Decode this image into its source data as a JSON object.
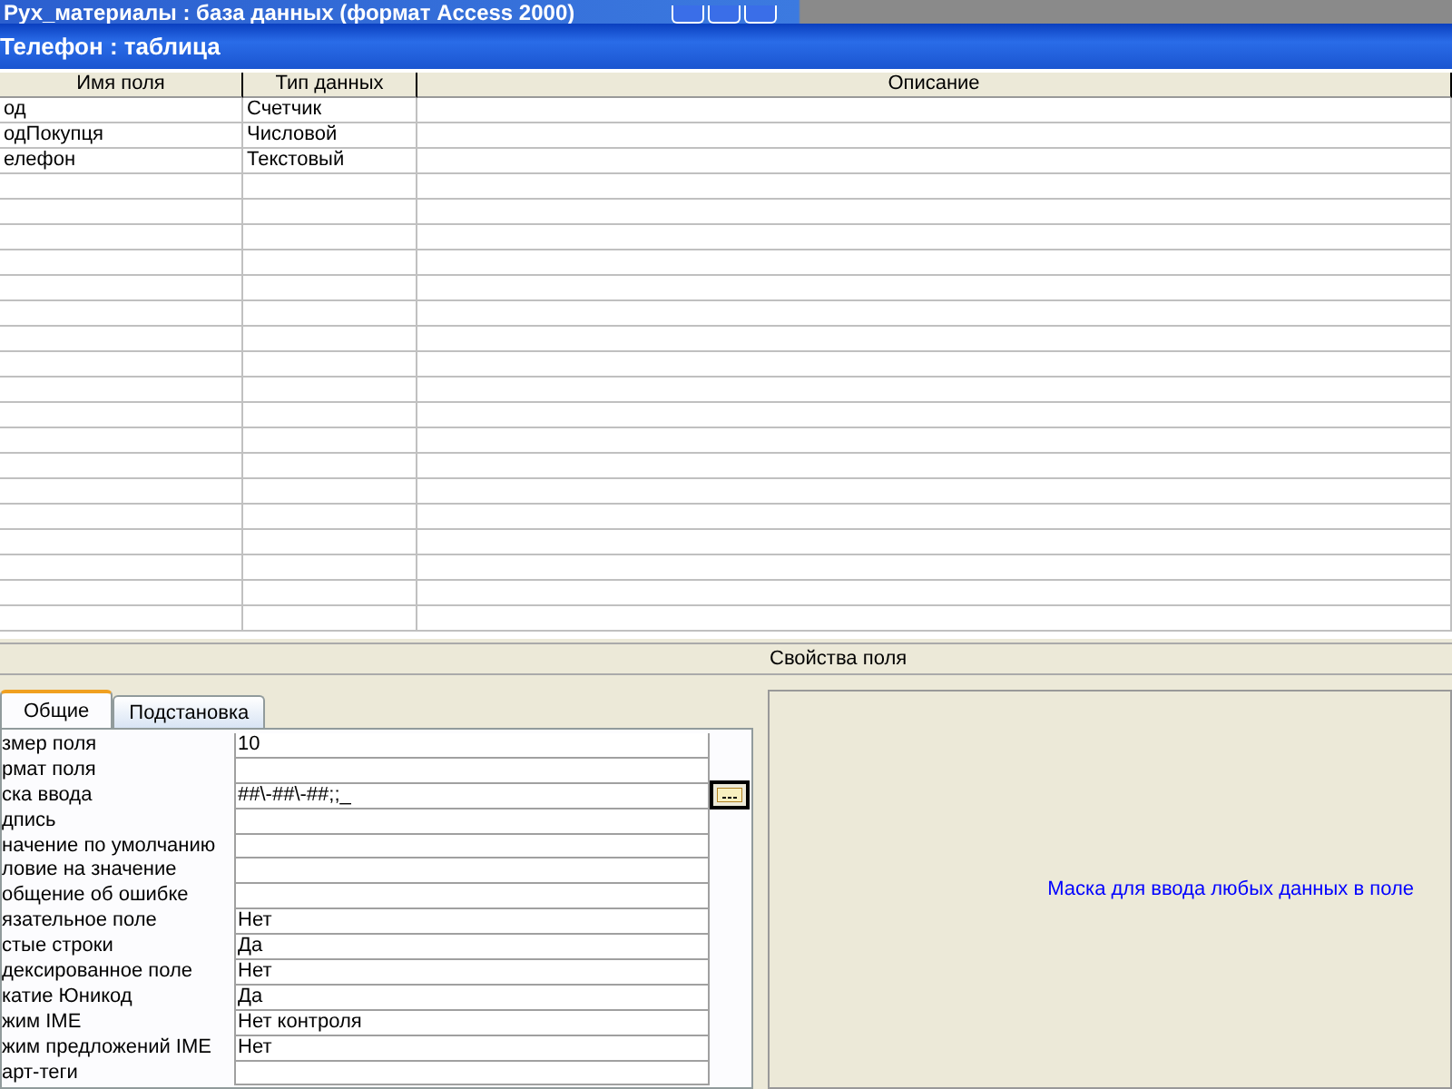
{
  "app_title": "Рух_материалы : база данных (формат Access 2000)",
  "window": {
    "title": "Телефон : таблица"
  },
  "table": {
    "columns": [
      "Имя поля",
      "Тип данных",
      "Описание"
    ],
    "rows": [
      {
        "name": "од",
        "type": "Счетчик"
      },
      {
        "name": "одПокупця",
        "type": "Числовой"
      },
      {
        "name": "елефон",
        "type": "Текстовый"
      }
    ]
  },
  "properties_title": "Свойства поля",
  "tabs": [
    {
      "label": "Общие",
      "selected": true
    },
    {
      "label": "Подстановка",
      "selected": false
    }
  ],
  "properties": [
    {
      "label": "змер поля",
      "value": "10"
    },
    {
      "label": "рмат поля"
    },
    {
      "label": "ска ввода",
      "value": "##\\-##\\-##;;_",
      "builder": true
    },
    {
      "label": "дпись"
    },
    {
      "label": "начение по умолчанию"
    },
    {
      "label": "ловие на значение"
    },
    {
      "label": "общение об ошибке"
    },
    {
      "label": "язательное поле",
      "value": "Нет"
    },
    {
      "label": "стые строки",
      "value": "Да"
    },
    {
      "label": "дексированное поле",
      "value": "Нет"
    },
    {
      "label": "катие Юникод",
      "value": "Да"
    },
    {
      "label": "жим IME",
      "value": "Нет контроля"
    },
    {
      "label": "жим предложений IME",
      "value": "Нет"
    },
    {
      "label": "арт-теги"
    }
  ],
  "help_text": "Маска для ввода любых данных в поле"
}
